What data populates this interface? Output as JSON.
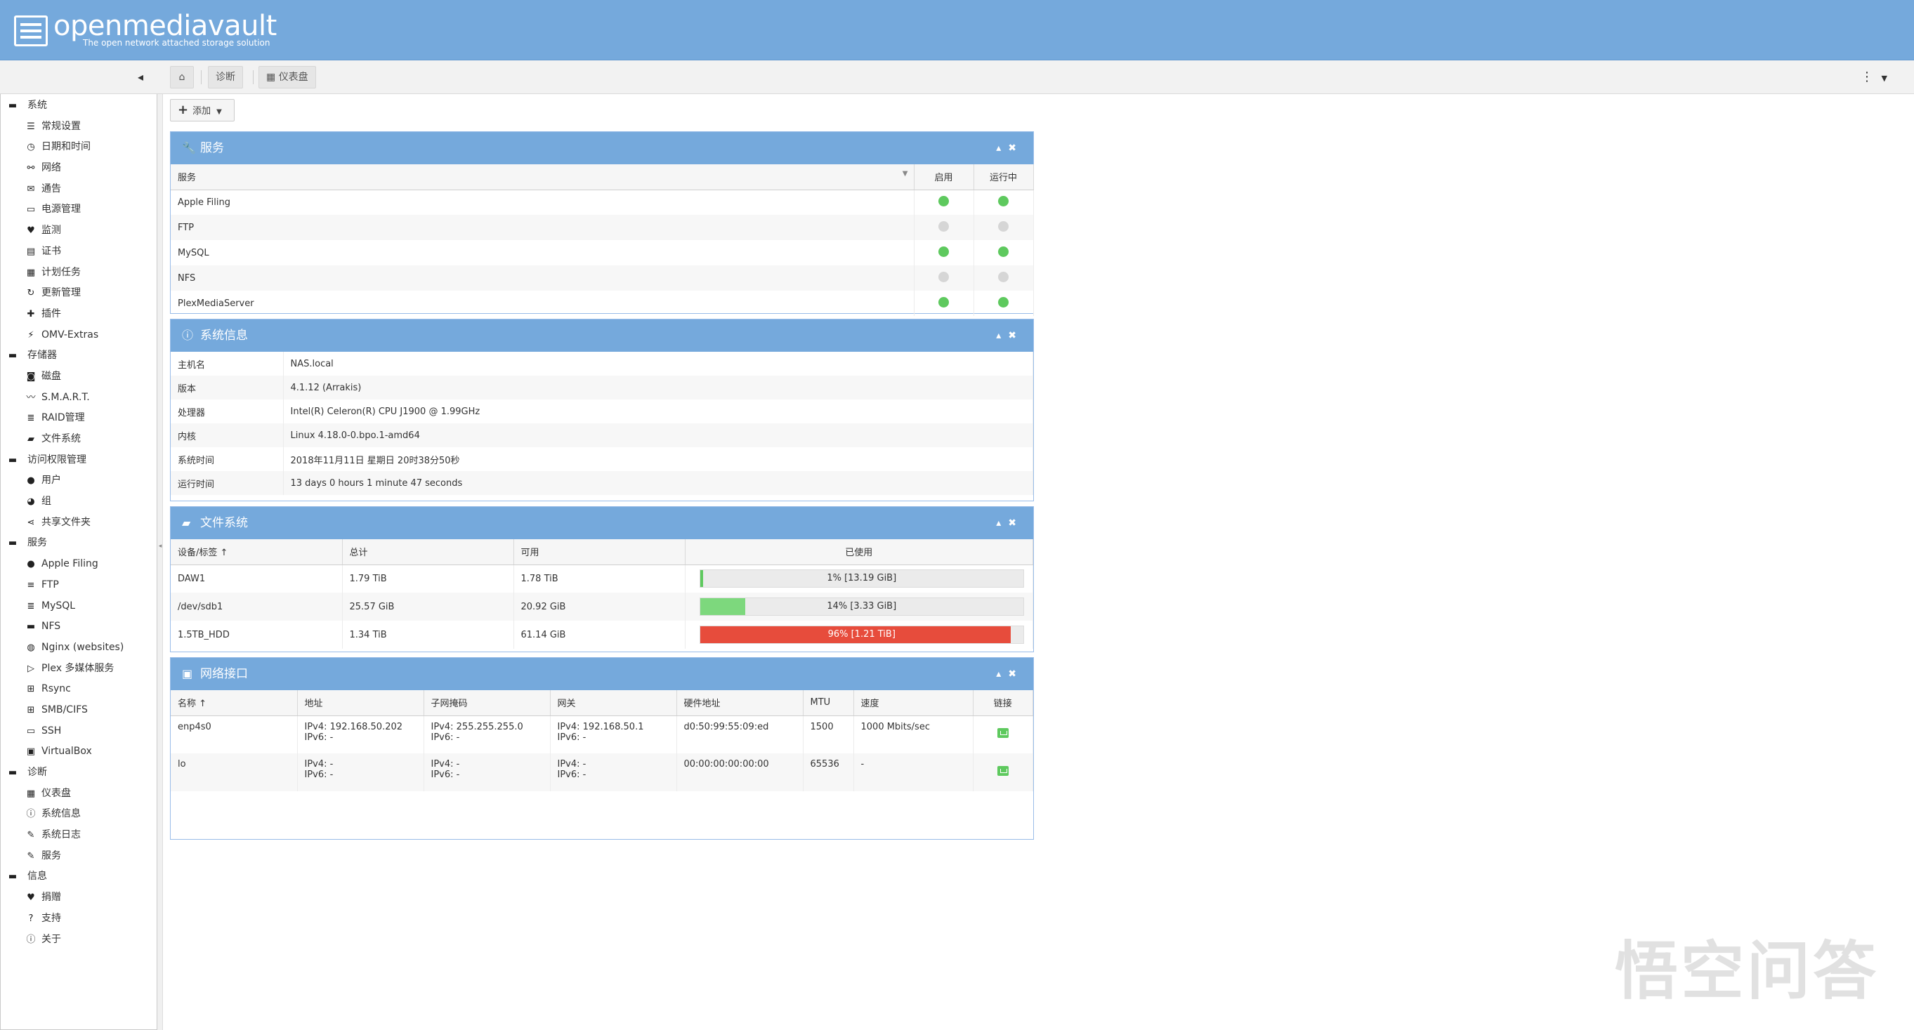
{
  "header": {
    "title": "openmediavault",
    "subtitle": "The open network attached storage solution"
  },
  "breadcrumb": {
    "parent": "诊断",
    "current": "仪表盘"
  },
  "toolbar": {
    "add_label": "添加"
  },
  "sidebar": [
    {
      "type": "group",
      "label": "系统",
      "icon": "minus"
    },
    {
      "type": "child",
      "label": "常规设置",
      "icon": "sliders"
    },
    {
      "type": "child",
      "label": "日期和时间",
      "icon": "clock"
    },
    {
      "type": "child",
      "label": "网络",
      "icon": "network"
    },
    {
      "type": "child",
      "label": "通告",
      "icon": "envelope"
    },
    {
      "type": "child",
      "label": "电源管理",
      "icon": "battery"
    },
    {
      "type": "child",
      "label": "监测",
      "icon": "heartbeat"
    },
    {
      "type": "child",
      "label": "证书",
      "icon": "certificate"
    },
    {
      "type": "child",
      "label": "计划任务",
      "icon": "calendar"
    },
    {
      "type": "child",
      "label": "更新管理",
      "icon": "refresh"
    },
    {
      "type": "child",
      "label": "插件",
      "icon": "puzzle"
    },
    {
      "type": "child",
      "label": "OMV-Extras",
      "icon": "plug"
    },
    {
      "type": "group",
      "label": "存储器",
      "icon": "minus"
    },
    {
      "type": "child",
      "label": "磁盘",
      "icon": "disk"
    },
    {
      "type": "child",
      "label": "S.M.A.R.T.",
      "icon": "pulse"
    },
    {
      "type": "child",
      "label": "RAID管理",
      "icon": "database"
    },
    {
      "type": "child",
      "label": "文件系统",
      "icon": "folder"
    },
    {
      "type": "group",
      "label": "访问权限管理",
      "icon": "minus"
    },
    {
      "type": "child",
      "label": "用户",
      "icon": "user"
    },
    {
      "type": "child",
      "label": "组",
      "icon": "users"
    },
    {
      "type": "child",
      "label": "共享文件夹",
      "icon": "share"
    },
    {
      "type": "group",
      "label": "服务",
      "icon": "minus"
    },
    {
      "type": "child",
      "label": "Apple Filing",
      "icon": "apple"
    },
    {
      "type": "child",
      "label": "FTP",
      "icon": "server"
    },
    {
      "type": "child",
      "label": "MySQL",
      "icon": "database"
    },
    {
      "type": "child",
      "label": "NFS",
      "icon": "desktop"
    },
    {
      "type": "child",
      "label": "Nginx (websites)",
      "icon": "globe"
    },
    {
      "type": "child",
      "label": "Plex 多媒体服务",
      "icon": "play"
    },
    {
      "type": "child",
      "label": "Rsync",
      "icon": "sitemap"
    },
    {
      "type": "child",
      "label": "SMB/CIFS",
      "icon": "windows"
    },
    {
      "type": "child",
      "label": "SSH",
      "icon": "terminal"
    },
    {
      "type": "child",
      "label": "VirtualBox",
      "icon": "cube"
    },
    {
      "type": "group",
      "label": "诊断",
      "icon": "minus"
    },
    {
      "type": "child",
      "label": "仪表盘",
      "icon": "dashboard"
    },
    {
      "type": "child",
      "label": "系统信息",
      "icon": "info"
    },
    {
      "type": "child",
      "label": "系统日志",
      "icon": "edit"
    },
    {
      "type": "child",
      "label": "服务",
      "icon": "wrench"
    },
    {
      "type": "group",
      "label": "信息",
      "icon": "minus"
    },
    {
      "type": "child",
      "label": "捐赠",
      "icon": "heart"
    },
    {
      "type": "child",
      "label": "支持",
      "icon": "question"
    },
    {
      "type": "child",
      "label": "关于",
      "icon": "info"
    }
  ],
  "services": {
    "title": "服务",
    "columns": [
      "服务",
      "启用",
      "运行中"
    ],
    "rows": [
      {
        "name": "Apple Filing",
        "enabled": true,
        "running": true
      },
      {
        "name": "FTP",
        "enabled": false,
        "running": false
      },
      {
        "name": "MySQL",
        "enabled": true,
        "running": true
      },
      {
        "name": "NFS",
        "enabled": false,
        "running": false
      },
      {
        "name": "PlexMediaServer",
        "enabled": true,
        "running": true
      }
    ]
  },
  "sysinfo": {
    "title": "系统信息",
    "rows": [
      {
        "k": "主机名",
        "v": "NAS.local"
      },
      {
        "k": "版本",
        "v": "4.1.12 (Arrakis)"
      },
      {
        "k": "处理器",
        "v": "Intel(R) Celeron(R) CPU J1900 @ 1.99GHz"
      },
      {
        "k": "内核",
        "v": "Linux 4.18.0-0.bpo.1-amd64"
      },
      {
        "k": "系统时间",
        "v": "2018年11月11日 星期日 20时38分50秒"
      },
      {
        "k": "运行时间",
        "v": "13 days 0 hours 1 minute 47 seconds"
      }
    ]
  },
  "filesystems": {
    "title": "文件系统",
    "columns": [
      "设备/标签 ↑",
      "总计",
      "可用",
      "已使用"
    ],
    "rows": [
      {
        "device": "DAW1",
        "total": "1.79 TiB",
        "avail": "1.78 TiB",
        "used_pct": 1,
        "used_label": "1% [13.19 GiB]",
        "color": "#5ec95e"
      },
      {
        "device": "/dev/sdb1",
        "total": "25.57 GiB",
        "avail": "20.92 GiB",
        "used_pct": 14,
        "used_label": "14% [3.33 GiB]",
        "color": "#7dd87d"
      },
      {
        "device": "1.5TB_HDD",
        "total": "1.34 TiB",
        "avail": "61.14 GiB",
        "used_pct": 96,
        "used_label": "96% [1.21 TiB]",
        "color": "#e74c3c"
      }
    ]
  },
  "network": {
    "title": "网络接口",
    "columns": [
      "名称 ↑",
      "地址",
      "子网掩码",
      "网关",
      "硬件地址",
      "MTU",
      "速度",
      "链接"
    ],
    "rows": [
      {
        "name": "enp4s0",
        "addr": [
          "IPv4: 192.168.50.202",
          "IPv6: -"
        ],
        "mask": [
          "IPv4: 255.255.255.0",
          "IPv6: -"
        ],
        "gw": [
          "IPv4: 192.168.50.1",
          "IPv6: -"
        ],
        "hw": "d0:50:99:55:09:ed",
        "mtu": "1500",
        "speed": "1000 Mbits/sec"
      },
      {
        "name": "lo",
        "addr": [
          "IPv4: -",
          "IPv6: -"
        ],
        "mask": [
          "IPv4: -",
          "IPv6: -"
        ],
        "gw": [
          "IPv4: -",
          "IPv6: -"
        ],
        "hw": "00:00:00:00:00:00",
        "mtu": "65536",
        "speed": "-"
      }
    ]
  },
  "watermark": "悟空问答",
  "colors": {
    "header": "#75a9dc",
    "green": "#5ec95e",
    "red": "#e74c3c"
  }
}
